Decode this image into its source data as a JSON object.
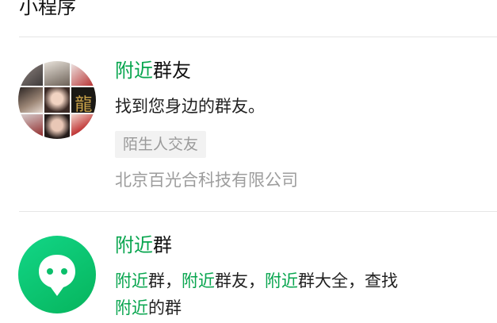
{
  "section_title": "小程序",
  "items": [
    {
      "title": [
        {
          "text": "附近",
          "highlight": true
        },
        {
          "text": "群友",
          "highlight": false
        }
      ],
      "description": "找到您身边的群友。",
      "tag": "陌生人交友",
      "developer": "北京百光合科技有限公司",
      "avatar_glyph": "龍"
    },
    {
      "title": [
        {
          "text": "附近",
          "highlight": true
        },
        {
          "text": "群",
          "highlight": false
        }
      ],
      "description_line1": [
        {
          "text": "附近",
          "highlight": true
        },
        {
          "text": "群，",
          "highlight": false
        },
        {
          "text": "附近",
          "highlight": true
        },
        {
          "text": "群友，",
          "highlight": false
        },
        {
          "text": "附近",
          "highlight": true
        },
        {
          "text": "群大全，查找",
          "highlight": false
        }
      ],
      "description_line2": [
        {
          "text": "附近",
          "highlight": true
        },
        {
          "text": "的群",
          "highlight": false
        }
      ]
    }
  ],
  "colors": {
    "highlight": "#07a54e",
    "icon_green": "#07c160",
    "divider": "#e6e6e6",
    "tag_bg": "#f2f2f2",
    "secondary_text": "#9d9d9d"
  },
  "icons": {
    "item1_avatar": "group-photo-collage-avatar",
    "item2_icon": "chat-bubble-location-icon"
  }
}
